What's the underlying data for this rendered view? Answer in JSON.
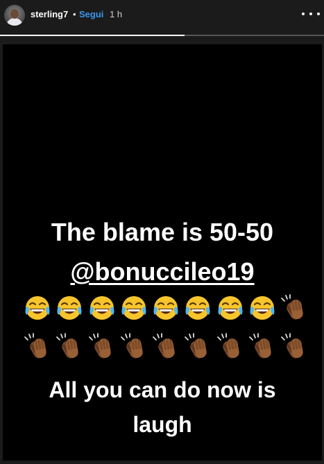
{
  "header": {
    "username": "sterling7",
    "separator": "•",
    "follow_label": "Segui",
    "time": "1 h",
    "more_icon": "more-horizontal-icon"
  },
  "progress": {
    "fraction": 0.57
  },
  "story": {
    "line1": "The blame is 50-50",
    "mention": "@bonuccileo19",
    "emoji_row1": [
      "laughing-tears",
      "laughing-tears",
      "laughing-tears",
      "laughing-tears",
      "laughing-tears",
      "laughing-tears",
      "laughing-tears",
      "laughing-tears",
      "clapping-hands"
    ],
    "emoji_row2": [
      "clapping-hands",
      "clapping-hands",
      "clapping-hands",
      "clapping-hands",
      "clapping-hands",
      "clapping-hands",
      "clapping-hands",
      "clapping-hands",
      "clapping-hands"
    ],
    "line3": "All you can do now is",
    "line4": "laugh"
  },
  "colors": {
    "follow": "#3897f0",
    "story_bg": "#000000",
    "text": "#ffffff"
  }
}
